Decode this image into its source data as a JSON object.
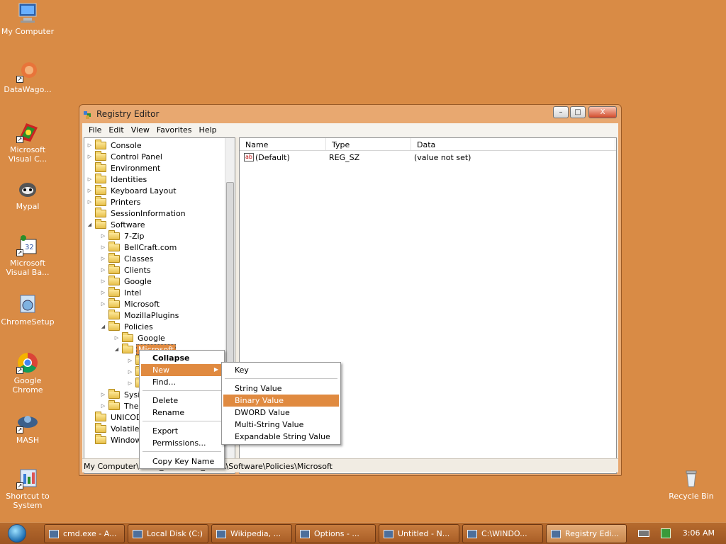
{
  "desktop": {
    "icons": [
      {
        "label": "My Computer"
      },
      {
        "label": "DataWago..."
      },
      {
        "label": "Microsoft Visual C..."
      },
      {
        "label": "Mypal"
      },
      {
        "label": "Microsoft Visual Ba..."
      },
      {
        "label": "ChromeSetup"
      },
      {
        "label": "Google Chrome"
      },
      {
        "label": "MASH"
      },
      {
        "label": "Shortcut to System"
      },
      {
        "label": "Recycle Bin"
      }
    ]
  },
  "window": {
    "title": "Registry Editor",
    "minimize_label": "–",
    "maximize_label": "□",
    "close_label": "X",
    "menu": [
      "File",
      "Edit",
      "View",
      "Favorites",
      "Help"
    ],
    "tree": [
      {
        "label": "Console",
        "exp": "▷"
      },
      {
        "label": "Control Panel",
        "exp": "▷"
      },
      {
        "label": "Environment",
        "exp": ""
      },
      {
        "label": "Identities",
        "exp": "▷"
      },
      {
        "label": "Keyboard Layout",
        "exp": "▷"
      },
      {
        "label": "Printers",
        "exp": "▷"
      },
      {
        "label": "SessionInformation",
        "exp": ""
      },
      {
        "label": "Software",
        "exp": "◢"
      },
      {
        "label": "7-Zip",
        "exp": "▷"
      },
      {
        "label": "BellCraft.com",
        "exp": "▷"
      },
      {
        "label": "Classes",
        "exp": "▷"
      },
      {
        "label": "Clients",
        "exp": "▷"
      },
      {
        "label": "Google",
        "exp": "▷"
      },
      {
        "label": "Intel",
        "exp": "▷"
      },
      {
        "label": "Microsoft",
        "exp": "▷"
      },
      {
        "label": "MozillaPlugins",
        "exp": ""
      },
      {
        "label": "Policies",
        "exp": "◢"
      },
      {
        "label": "Google",
        "exp": "▷"
      },
      {
        "label": "Microsoft",
        "exp": "◢"
      },
      {
        "label": "",
        "exp": "▷"
      },
      {
        "label": "",
        "exp": "▷"
      },
      {
        "label": "",
        "exp": "▷"
      },
      {
        "label": "Sysin",
        "exp": "▷"
      },
      {
        "label": "Theo",
        "exp": "▷"
      },
      {
        "label": "UNICODI",
        "exp": ""
      },
      {
        "label": "Volatile E",
        "exp": ""
      },
      {
        "label": "Window",
        "exp": ""
      }
    ],
    "columns": {
      "name": "Name",
      "type": "Type",
      "data": "Data"
    },
    "values": [
      {
        "name": "(Default)",
        "type": "REG_SZ",
        "data": "(value not set)",
        "icon": "ab"
      }
    ],
    "status": "My Computer\\HKEY_CURRENT_USER\\Software\\Policies\\Microsoft"
  },
  "context_menu": {
    "items": [
      "Collapse",
      "New",
      "Find...",
      "Delete",
      "Rename",
      "Export",
      "Permissions...",
      "Copy Key Name"
    ],
    "submenu_arrow": "▶"
  },
  "new_submenu": {
    "items": [
      "Key",
      "String Value",
      "Binary Value",
      "DWORD Value",
      "Multi-String Value",
      "Expandable String Value"
    ]
  },
  "taskbar": {
    "buttons": [
      "cmd.exe - A...",
      "Local Disk (C:)",
      "Wikipedia, ...",
      "Options - ...",
      "Untitled - N...",
      "C:\\WINDO...",
      "Registry Edi..."
    ],
    "clock": "3:06 AM"
  },
  "colors": {
    "desktop": "#d98b45",
    "highlight": "#e08a40"
  }
}
